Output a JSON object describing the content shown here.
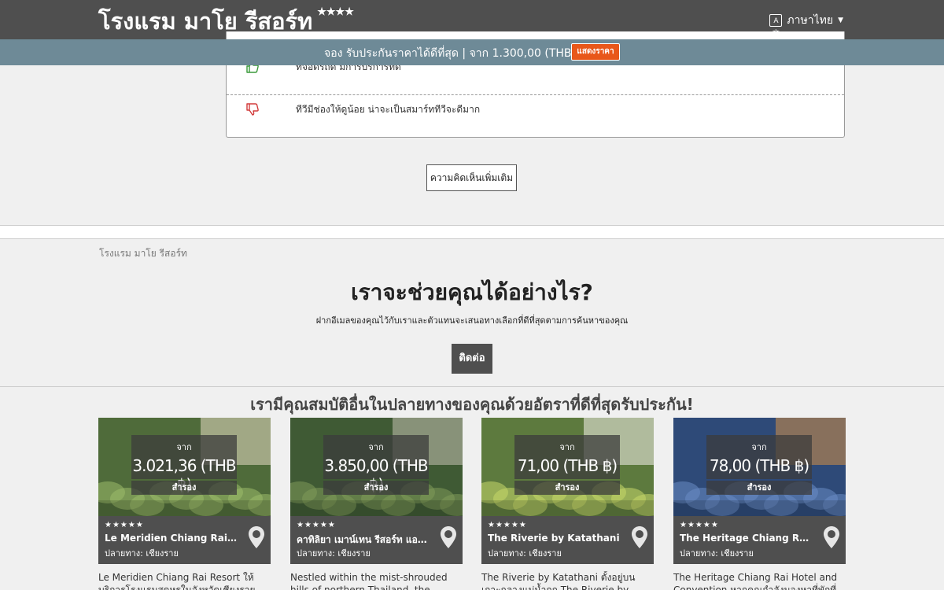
{
  "header": {
    "title": "โรงแรม มาโย รีสอร์ท",
    "stars": "★★★★",
    "language": "ภาษาไทย",
    "language_icon_text": "A文"
  },
  "booking_bar": {
    "text": "จอง รับประกันราคาได้ดีที่สุด | จาก 1.300,00 (THB ฿)",
    "button": "แสดงราคา"
  },
  "reviews": [
    {
      "type": "positive",
      "icon": "thumbs-up-icon",
      "text": "ที่จอดรถดี มีการบริการที่ดี"
    },
    {
      "type": "negative",
      "icon": "thumbs-down-icon",
      "text": "ทีวีมีช่องให้ดูน้อย น่าจะเป็นสมาร์ททีวีจะดีมาก"
    }
  ],
  "more_reviews_button": "ความคิดเห็นเพิ่มเติม",
  "breadcrumb": "โรงแรม มาโย รีสอร์ท",
  "help": {
    "title": "เราจะช่วยคุณได้อย่างไร?",
    "subtitle": "ฝากอีเมลของคุณไว้กับเราและตัวแทนจะเสนอทางเลือกที่ดีที่สุดตามการค้นหาของคุณ",
    "contact_button": "ติดต่อ"
  },
  "offers": {
    "title": "เรามีคุณสมบัติอื่นในปลายทางของคุณด้วยอัตราที่ดีที่สุดรับประกัน!",
    "cards": [
      {
        "from": "จาก",
        "price": "3.021,36 (THB ฿)",
        "reserve": "สำรอง",
        "stars": "★★★★★",
        "name": "Le Meridien Chiang Rai Re...",
        "destination": "ปลายทาง: เชียงราย",
        "description": "Le Meridien Chiang Rai Resort ให้บริการโรงแรมสุดหรูในจังหวัดเชียงรายพร้อมสระ",
        "colors": {
          "bg": "#4f6b3a",
          "accent": "#9dbb6a",
          "light": "#d9d0b8"
        }
      },
      {
        "from": "จาก",
        "price": "3.850,00 (THB ฿)",
        "reserve": "สำรอง",
        "stars": "★★★★★",
        "name": "คาทิลิยา เมาน์เทน รีสอร์ท แอนด์...",
        "destination": "ปลายทาง: เชียงราย",
        "description": "Nestled within the mist-shrouded hills of northern Thailand, the luxurious",
        "colors": {
          "bg": "#3f5a34",
          "accent": "#7f9a5a",
          "light": "#b9b7a8"
        }
      },
      {
        "from": "จาก",
        "price": "71,00 (THB ฿)",
        "reserve": "สำรอง",
        "stars": "★★★★★",
        "name": "The Riverie by Katathani",
        "destination": "ปลายทาง: เชียงราย",
        "description": "The Riverie by Katathani ตั้งอยู่บนเกาะกลางแม่น้ำกก The Riverie by Katathani ตั้ง",
        "colors": {
          "bg": "#5d7a3e",
          "accent": "#c7d86a",
          "light": "#e8e6de"
        }
      },
      {
        "from": "จาก",
        "price": "78,00 (THB ฿)",
        "reserve": "สำรอง",
        "stars": "★★★★★",
        "name": "The Heritage Chiang Rai H...",
        "destination": "ปลายทาง: เชียงราย",
        "description": "The Heritage Chiang Rai Hotel and Convention หากคุณกำลังมองหาที่พักที่สะดวก",
        "colors": {
          "bg": "#2e4a78",
          "accent": "#6a8cc4",
          "light": "#c48a4a"
        }
      }
    ]
  }
}
